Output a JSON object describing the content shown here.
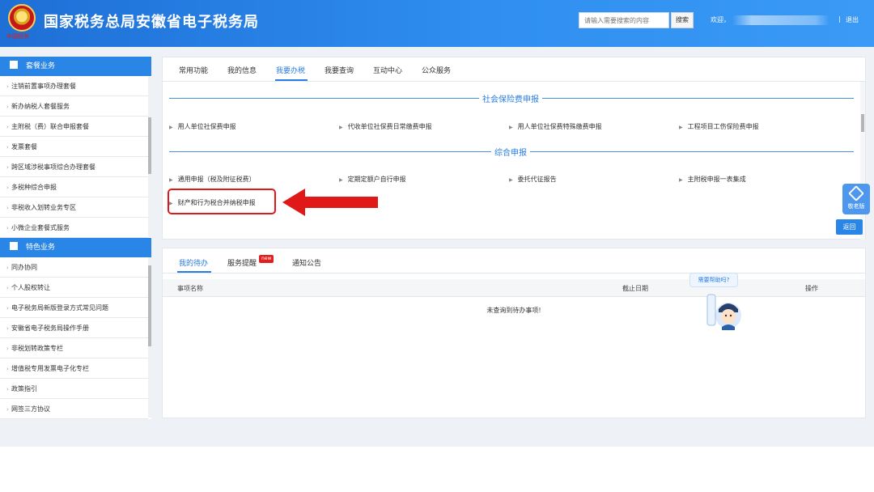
{
  "header": {
    "emblem_script": "中国税务",
    "site_title": "国家税务总局安徽省电子税务局",
    "search_placeholder": "请输入需要搜索的内容",
    "search_button": "搜索",
    "welcome": "欢迎，",
    "separator": "|",
    "logout": "退出"
  },
  "sidebar": {
    "section1": {
      "title": "套餐业务",
      "items": [
        "注销前置事项办理套餐",
        "新办纳税人套餐服务",
        "主附税（费）联合申报套餐",
        "发票套餐",
        "跨区域涉税事项综合办理套餐",
        "多税种综合申报",
        "非税收入划转业务专区",
        "小微企业套餐式服务"
      ]
    },
    "section2": {
      "title": "特色业务",
      "items": [
        "同办协同",
        "个人股权转让",
        "电子税务局新版登录方式常见问题",
        "安徽省电子税务局操作手册",
        "非税划转政策专栏",
        "增值税专用发票电子化专栏",
        "政策指引",
        "网签三方协议"
      ]
    }
  },
  "main": {
    "tabs": [
      "常用功能",
      "我的信息",
      "我要办税",
      "我要查询",
      "互动中心",
      "公众服务"
    ],
    "active_tab": "我要办税",
    "group1": {
      "title": "社会保险费申报",
      "items": [
        "用人单位社保费申报",
        "代收单位社保费日常缴费申报",
        "用人单位社保费特殊缴费申报",
        "工程项目工伤保险费申报"
      ]
    },
    "group2": {
      "title": "综合申报",
      "items": [
        "通用申报（税及附征税费）",
        "定期定额户自行申报",
        "委托代征报告",
        "主附税申报一表集成"
      ],
      "highlighted_item": "财产和行为税合并纳税申报"
    },
    "elder_label": "敬老版",
    "back_button": "返回"
  },
  "bottom": {
    "tabs": [
      "我的待办",
      "服务提醒",
      "通知公告"
    ],
    "new_badge": "new",
    "columns": [
      "事项名称",
      "截止日期",
      "操作"
    ],
    "empty_message": "未查询到待办事项!"
  },
  "help": {
    "bubble": "需要帮助吗?"
  },
  "colors": {
    "primary": "#2a86e6",
    "header_gradient_start": "#1e6fd6",
    "highlight_red": "#e01818"
  }
}
